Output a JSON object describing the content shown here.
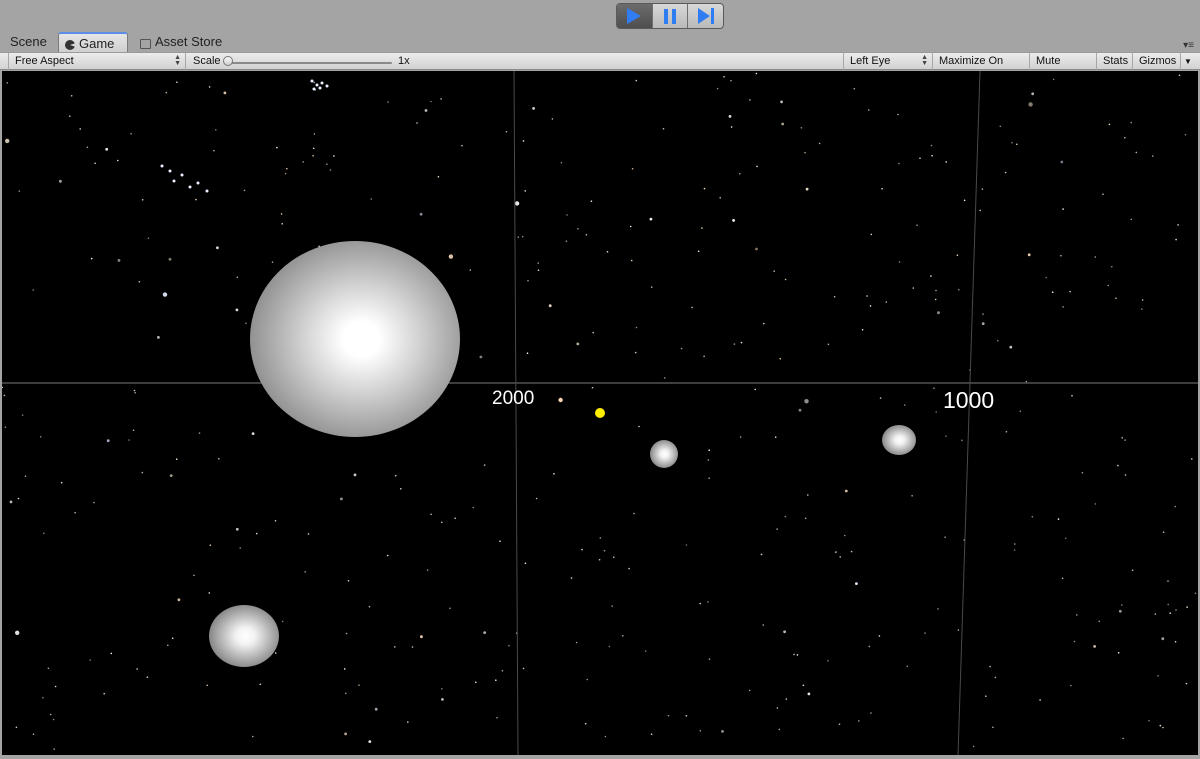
{
  "playbar": {
    "play_icon": "play-icon",
    "pause_icon": "pause-icon",
    "step_icon": "step-icon",
    "accent_color": "#2f7df2"
  },
  "tabs": [
    {
      "label": "Scene",
      "icon": "",
      "active": false
    },
    {
      "label": "Game",
      "icon": "game-controller-icon",
      "active": true
    },
    {
      "label": "Asset Store",
      "icon": "shopping-bag-icon",
      "active": false
    }
  ],
  "toolbar": {
    "aspect": "Free Aspect",
    "scale_label": "Scale",
    "scale_value": "1x",
    "eye": "Left Eye",
    "maximize": "Maximize On Play",
    "mute": "Mute Audio",
    "stats": "Stats",
    "gizmos": "Gizmos"
  },
  "scene": {
    "grid_labels": [
      "2000",
      "1000"
    ],
    "background_color": "#000000",
    "player_marker_color": "#ffee00"
  }
}
